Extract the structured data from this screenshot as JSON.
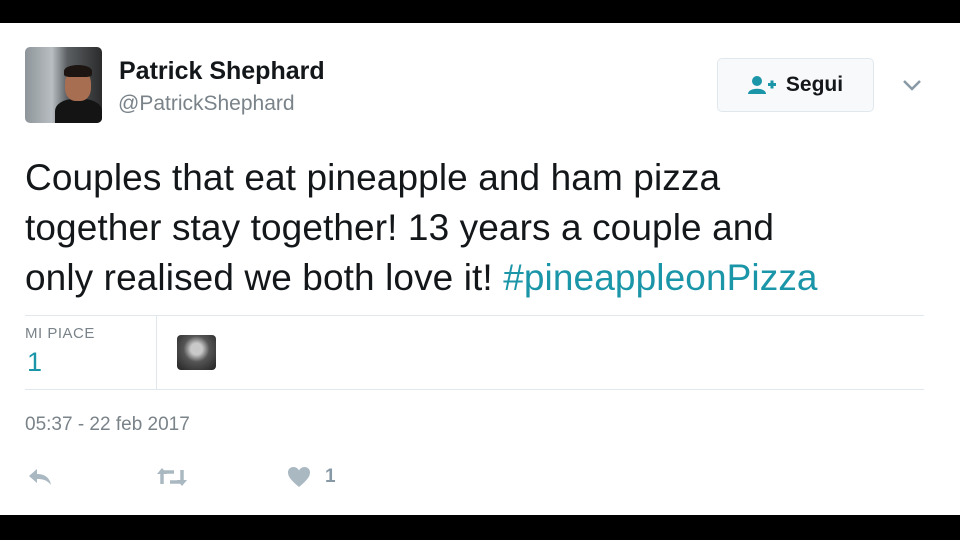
{
  "author": {
    "name": "Patrick Shephard",
    "handle": "@PatrickShephard"
  },
  "follow_button": {
    "label": "Segui",
    "icon": "add-user-icon"
  },
  "tweet": {
    "text_lines": [
      "Couples that eat pineapple and ham pizza",
      "together stay together! 13 years a couple and",
      "only realised we both love it! "
    ],
    "hashtag": "#pineappleonPizza"
  },
  "stats": {
    "likes_label": "MI PIACE",
    "likes_count": "1"
  },
  "timestamp": "05:37 - 22 feb 2017",
  "actions": {
    "reply_icon": "reply-icon",
    "retweet_icon": "retweet-icon",
    "like_icon": "heart-icon",
    "like_count": "1"
  },
  "colors": {
    "accent": "#1b95a8",
    "text": "#14171a",
    "muted": "#7a8389",
    "icon": "#aab8c2"
  }
}
